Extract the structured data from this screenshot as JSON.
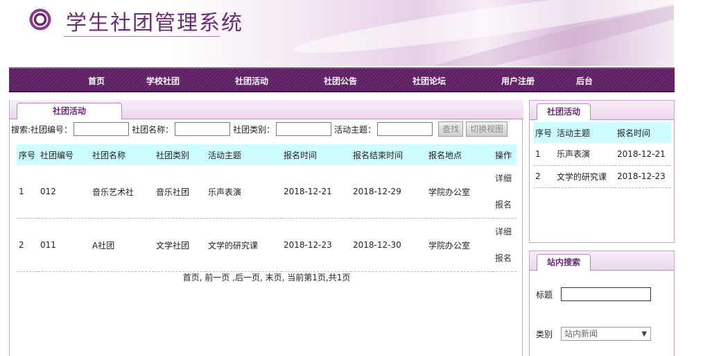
{
  "site": {
    "title": "学生社团管理系统"
  },
  "nav": [
    "首页",
    "学校社团",
    "社团活动",
    "社团公告",
    "社团论坛",
    "用户注册",
    "后台"
  ],
  "main": {
    "tab": "社团活动",
    "search": {
      "prefix": "搜索:",
      "fields": [
        "社团编号：",
        "社团名称：",
        "社团类别：",
        "活动主题："
      ],
      "find_label": "查找",
      "switch_label": "切换视图"
    },
    "table": {
      "headers": [
        "序号",
        "社团编号",
        "社团名称",
        "社团类别",
        "活动主题",
        "报名时间",
        "报名结束时间",
        "报名地点",
        "操作"
      ],
      "rows": [
        {
          "cells": [
            "1",
            "012",
            "音乐艺术社",
            "音乐社团",
            "乐声表演",
            "2018-12-21",
            "2018-12-29",
            "学院办公室"
          ],
          "ops": [
            "详细",
            "报名"
          ]
        },
        {
          "cells": [
            "2",
            "011",
            "A社团",
            "文学社团",
            "文学的研究课",
            "2018-12-23",
            "2018-12-30",
            "学院办公室"
          ],
          "ops": [
            "详细",
            "报名"
          ]
        }
      ]
    },
    "pager": {
      "first": "首页",
      "prev": "前一页",
      "next": "后一页",
      "last": "末页",
      "status": "当前第1页,共1页"
    }
  },
  "side_activity": {
    "tab": "社团活动",
    "headers": [
      "序号",
      "活动主题",
      "报名时间"
    ],
    "rows": [
      [
        "1",
        "乐声表演",
        "2018-12-21"
      ],
      [
        "2",
        "文学的研究课",
        "2018-12-23"
      ]
    ]
  },
  "side_search": {
    "tab": "站内搜索",
    "title_label": "标题",
    "title_value": "",
    "category_label": "类别",
    "category_value": "站内新闻"
  }
}
